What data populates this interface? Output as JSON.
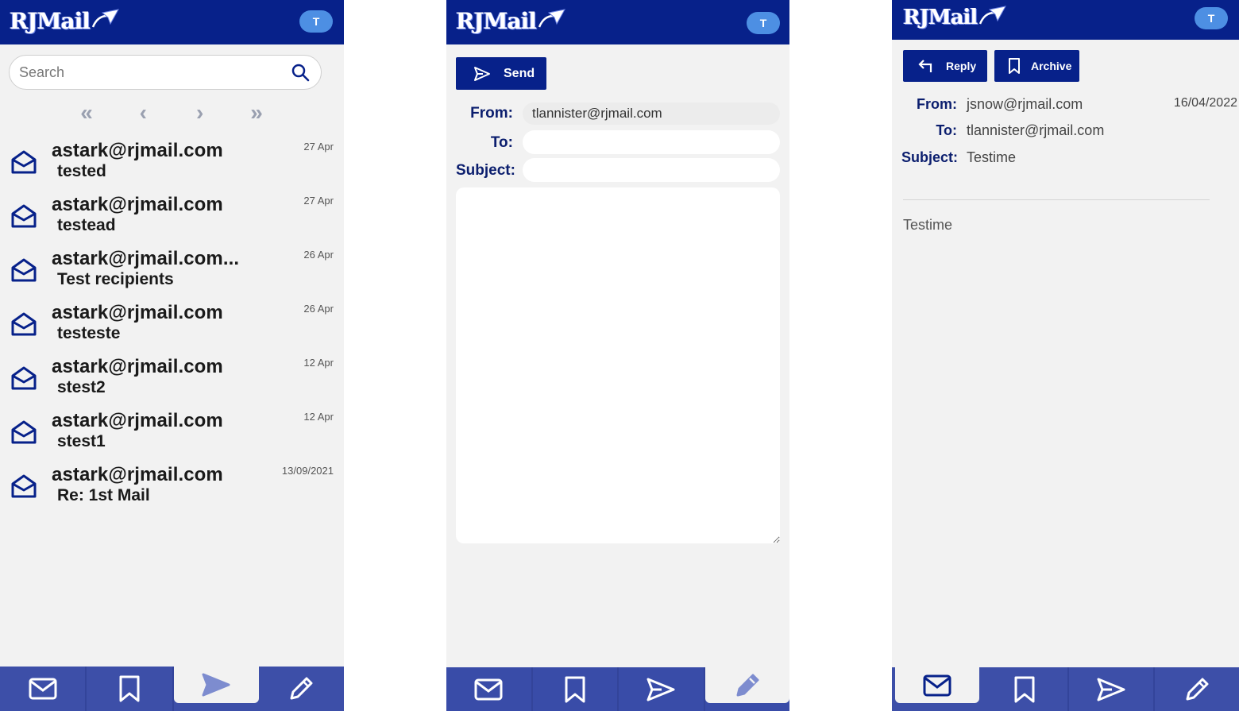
{
  "app": {
    "logo_text": "RJMail",
    "avatar_initial": "T"
  },
  "inbox": {
    "search_placeholder": "Search",
    "pager": {
      "first": "«",
      "prev": "‹",
      "next": "›",
      "last": "»"
    },
    "messages": [
      {
        "sender": "astark@rjmail.com",
        "subject": "tested",
        "date": "27 Apr"
      },
      {
        "sender": "astark@rjmail.com",
        "subject": "testead",
        "date": "27 Apr"
      },
      {
        "sender": "astark@rjmail.com...",
        "subject": "Test recipients",
        "date": "26 Apr"
      },
      {
        "sender": "astark@rjmail.com",
        "subject": "testeste",
        "date": "26 Apr"
      },
      {
        "sender": "astark@rjmail.com",
        "subject": "stest2",
        "date": "12 Apr"
      },
      {
        "sender": "astark@rjmail.com",
        "subject": "stest1",
        "date": "12 Apr"
      },
      {
        "sender": "astark@rjmail.com",
        "subject": "Re: 1st Mail",
        "date": "13/09/2021"
      }
    ],
    "active_nav": "sent"
  },
  "compose": {
    "send_label": "Send",
    "from_label": "From:",
    "from_value": "tlannister@rjmail.com",
    "to_label": "To:",
    "to_value": "",
    "subject_label": "Subject:",
    "subject_value": "",
    "body_value": "",
    "active_nav": "compose"
  },
  "read": {
    "reply_label": "Reply",
    "archive_label": "Archive",
    "from_label": "From:",
    "from_value": "jsnow@rjmail.com",
    "date": "16/04/2022",
    "to_label": "To:",
    "to_value": "tlannister@rjmail.com",
    "subject_label": "Subject:",
    "subject_value": "Testime",
    "body": "Testime",
    "active_nav": "inbox"
  },
  "nav_items": [
    {
      "id": "inbox",
      "icon": "mail-icon"
    },
    {
      "id": "archive",
      "icon": "bookmark-icon"
    },
    {
      "id": "sent",
      "icon": "send-icon"
    },
    {
      "id": "compose",
      "icon": "pencil-icon"
    }
  ],
  "colors": {
    "brand": "#07218a",
    "navbar": "#3d4fa8",
    "avatar": "#4d8fe3",
    "background": "#f2f2f2",
    "label": "#0b1e6e"
  }
}
